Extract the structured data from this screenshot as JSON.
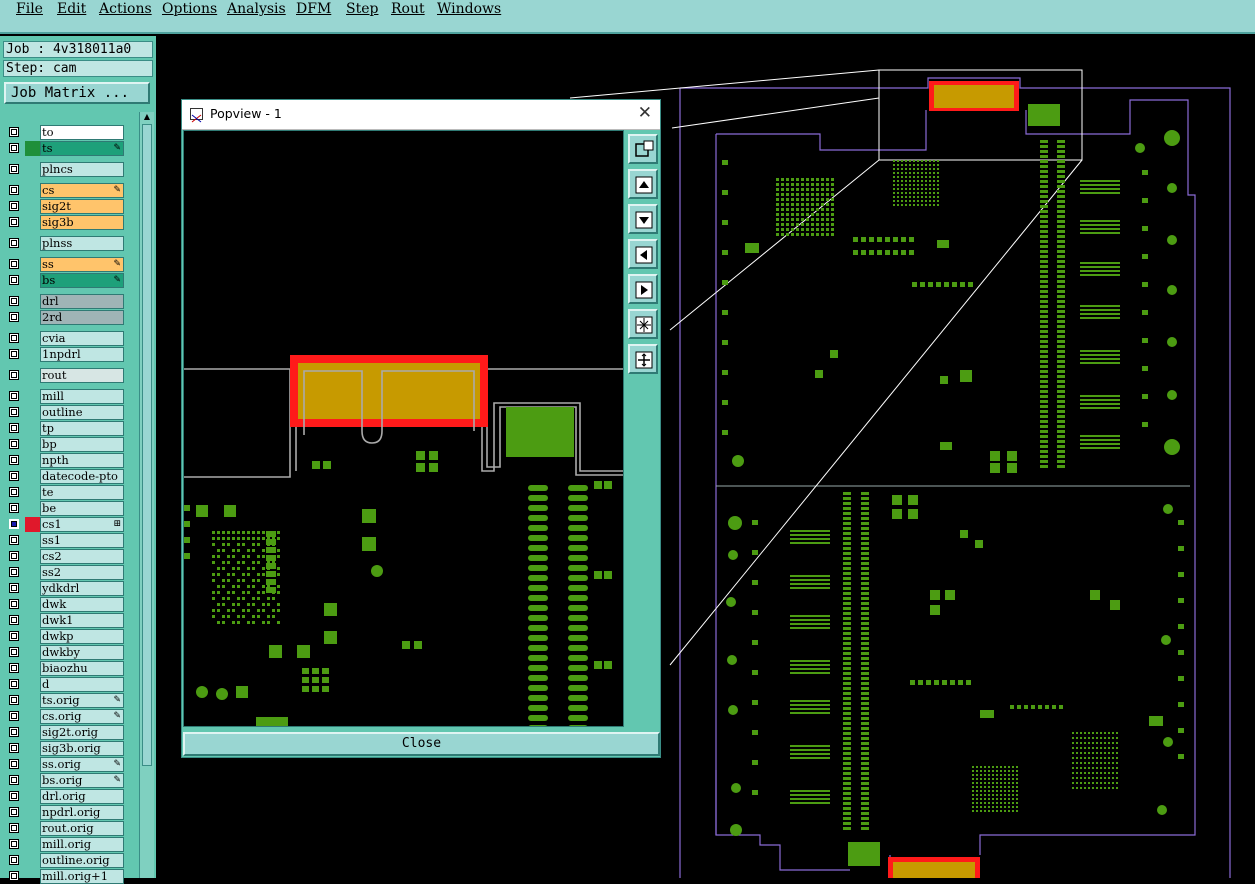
{
  "menu": [
    "File",
    "Edit",
    "Actions",
    "Options",
    "Analysis",
    "DFM",
    "Step",
    "Rout",
    "Windows"
  ],
  "job": {
    "job_line": "Job : 4v318011a0",
    "step_line": "Step: cam",
    "matrix_button": "Job Matrix ..."
  },
  "layers": [
    {
      "name": "to",
      "color": "",
      "bg": "#ffffff",
      "flag": ""
    },
    {
      "name": "ts",
      "color": "#1f8f3a",
      "bg": "#1ea07a",
      "flag": "✎"
    },
    {
      "name": "plncs",
      "color": "",
      "bg": "#bfe6e3",
      "flag": ""
    },
    {
      "name": "cs",
      "color": "",
      "bg": "#ffc46b",
      "flag": "✎"
    },
    {
      "name": "sig2t",
      "color": "",
      "bg": "#ffc46b",
      "flag": ""
    },
    {
      "name": "sig3b",
      "color": "",
      "bg": "#ffc46b",
      "flag": ""
    },
    {
      "name": "plnss",
      "color": "",
      "bg": "#bfe6e3",
      "flag": ""
    },
    {
      "name": "ss",
      "color": "",
      "bg": "#ffc46b",
      "flag": "✎"
    },
    {
      "name": "bs",
      "color": "",
      "bg": "#1ea07a",
      "flag": "✎"
    },
    {
      "name": "drl",
      "color": "",
      "bg": "#9fb4b6",
      "flag": ""
    },
    {
      "name": "2rd",
      "color": "",
      "bg": "#9fb4b6",
      "flag": ""
    },
    {
      "name": "cvia",
      "color": "",
      "bg": "#bfe6e3",
      "flag": ""
    },
    {
      "name": "1npdrl",
      "color": "",
      "bg": "#bfe6e3",
      "flag": ""
    },
    {
      "name": "rout",
      "color": "",
      "bg": "#d7e6e4",
      "flag": ""
    },
    {
      "name": "mill",
      "color": "",
      "bg": "#bfe6e3",
      "flag": ""
    },
    {
      "name": "outline",
      "color": "",
      "bg": "#bfe6e3",
      "flag": ""
    },
    {
      "name": "tp",
      "color": "",
      "bg": "#bfe6e3",
      "flag": ""
    },
    {
      "name": "bp",
      "color": "",
      "bg": "#bfe6e3",
      "flag": ""
    },
    {
      "name": "npth",
      "color": "",
      "bg": "#bfe6e3",
      "flag": ""
    },
    {
      "name": "datecode-pto",
      "color": "",
      "bg": "#bfe6e3",
      "flag": ""
    },
    {
      "name": "te",
      "color": "",
      "bg": "#bfe6e3",
      "flag": ""
    },
    {
      "name": "be",
      "color": "",
      "bg": "#bfe6e3",
      "flag": ""
    },
    {
      "name": "cs1",
      "color": "#e0182b",
      "bg": "#bfe6e3",
      "flag": "⊞",
      "active": true
    },
    {
      "name": "ss1",
      "color": "",
      "bg": "#bfe6e3",
      "flag": ""
    },
    {
      "name": "cs2",
      "color": "",
      "bg": "#bfe6e3",
      "flag": ""
    },
    {
      "name": "ss2",
      "color": "",
      "bg": "#bfe6e3",
      "flag": ""
    },
    {
      "name": "ydkdrl",
      "color": "",
      "bg": "#bfe6e3",
      "flag": ""
    },
    {
      "name": "dwk",
      "color": "",
      "bg": "#bfe6e3",
      "flag": ""
    },
    {
      "name": "dwk1",
      "color": "",
      "bg": "#bfe6e3",
      "flag": ""
    },
    {
      "name": "dwkp",
      "color": "",
      "bg": "#bfe6e3",
      "flag": ""
    },
    {
      "name": "dwkby",
      "color": "",
      "bg": "#bfe6e3",
      "flag": ""
    },
    {
      "name": "biaozhu",
      "color": "",
      "bg": "#bfe6e3",
      "flag": ""
    },
    {
      "name": "d",
      "color": "",
      "bg": "#bfe6e3",
      "flag": ""
    },
    {
      "name": "ts.orig",
      "color": "",
      "bg": "#bfe6e3",
      "flag": "✎"
    },
    {
      "name": "cs.orig",
      "color": "",
      "bg": "#bfe6e3",
      "flag": "✎"
    },
    {
      "name": "sig2t.orig",
      "color": "",
      "bg": "#bfe6e3",
      "flag": ""
    },
    {
      "name": "sig3b.orig",
      "color": "",
      "bg": "#bfe6e3",
      "flag": ""
    },
    {
      "name": "ss.orig",
      "color": "",
      "bg": "#bfe6e3",
      "flag": "✎"
    },
    {
      "name": "bs.orig",
      "color": "",
      "bg": "#bfe6e3",
      "flag": "✎"
    },
    {
      "name": "drl.orig",
      "color": "",
      "bg": "#bfe6e3",
      "flag": ""
    },
    {
      "name": "npdrl.orig",
      "color": "",
      "bg": "#bfe6e3",
      "flag": ""
    },
    {
      "name": "rout.orig",
      "color": "",
      "bg": "#bfe6e3",
      "flag": ""
    },
    {
      "name": "mill.orig",
      "color": "",
      "bg": "#bfe6e3",
      "flag": ""
    },
    {
      "name": "outline.orig",
      "color": "",
      "bg": "#bfe6e3",
      "flag": ""
    },
    {
      "name": "mill.orig+1",
      "color": "",
      "bg": "#bfe6e3",
      "flag": ""
    }
  ],
  "popview": {
    "title": "Popview - 1",
    "close_button": "Close",
    "tools": [
      "zoom-window-icon",
      "pan-up-icon",
      "pan-down-icon",
      "pan-left-icon",
      "pan-right-icon",
      "zoom-fit-icon",
      "zoom-home-icon"
    ]
  },
  "colors": {
    "menubar": "#99d6d2",
    "panel": "#62c7b0",
    "pad_green": "#4c9c12",
    "pad_gold": "#c79a00",
    "highlight_red": "#ff1a1a",
    "outline_purple": "#8a6bd6"
  }
}
